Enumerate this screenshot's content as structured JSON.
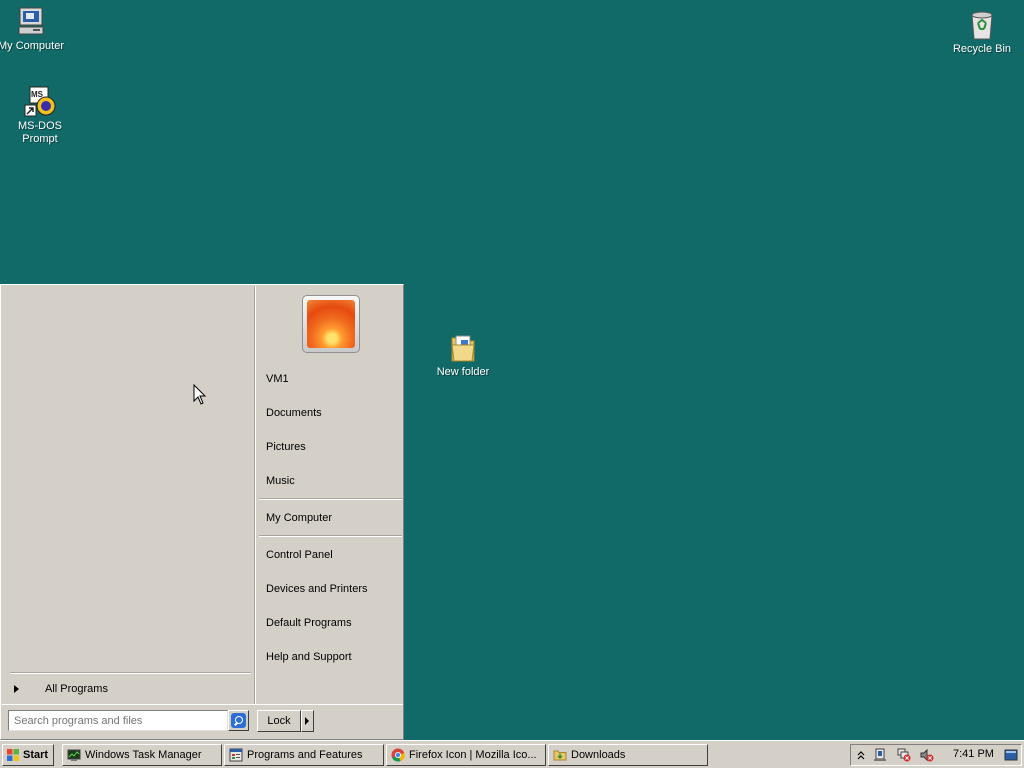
{
  "desktop": {
    "icons": {
      "my_computer": "My Computer",
      "msdos_line1": "MS-DOS",
      "msdos_line2": "Prompt",
      "recycle_bin": "Recycle Bin",
      "new_folder": "New folder"
    }
  },
  "start_menu": {
    "right_items": {
      "user": "VM1",
      "documents": "Documents",
      "pictures": "Pictures",
      "music": "Music",
      "my_computer": "My Computer",
      "control_panel": "Control Panel",
      "devices_printers": "Devices and Printers",
      "default_programs": "Default Programs",
      "help_support": "Help and Support"
    },
    "all_programs": "All Programs",
    "search_placeholder": "Search programs and files",
    "lock_label": "Lock"
  },
  "taskbar": {
    "start_label": "Start",
    "buttons": [
      "Windows Task Manager",
      "Programs and Features",
      "Firefox Icon | Mozilla Ico...",
      "Downloads"
    ],
    "clock": "7:41 PM"
  },
  "colors": {
    "desktop_bg": "#116a68",
    "panel_bg": "#d4d0c8"
  }
}
